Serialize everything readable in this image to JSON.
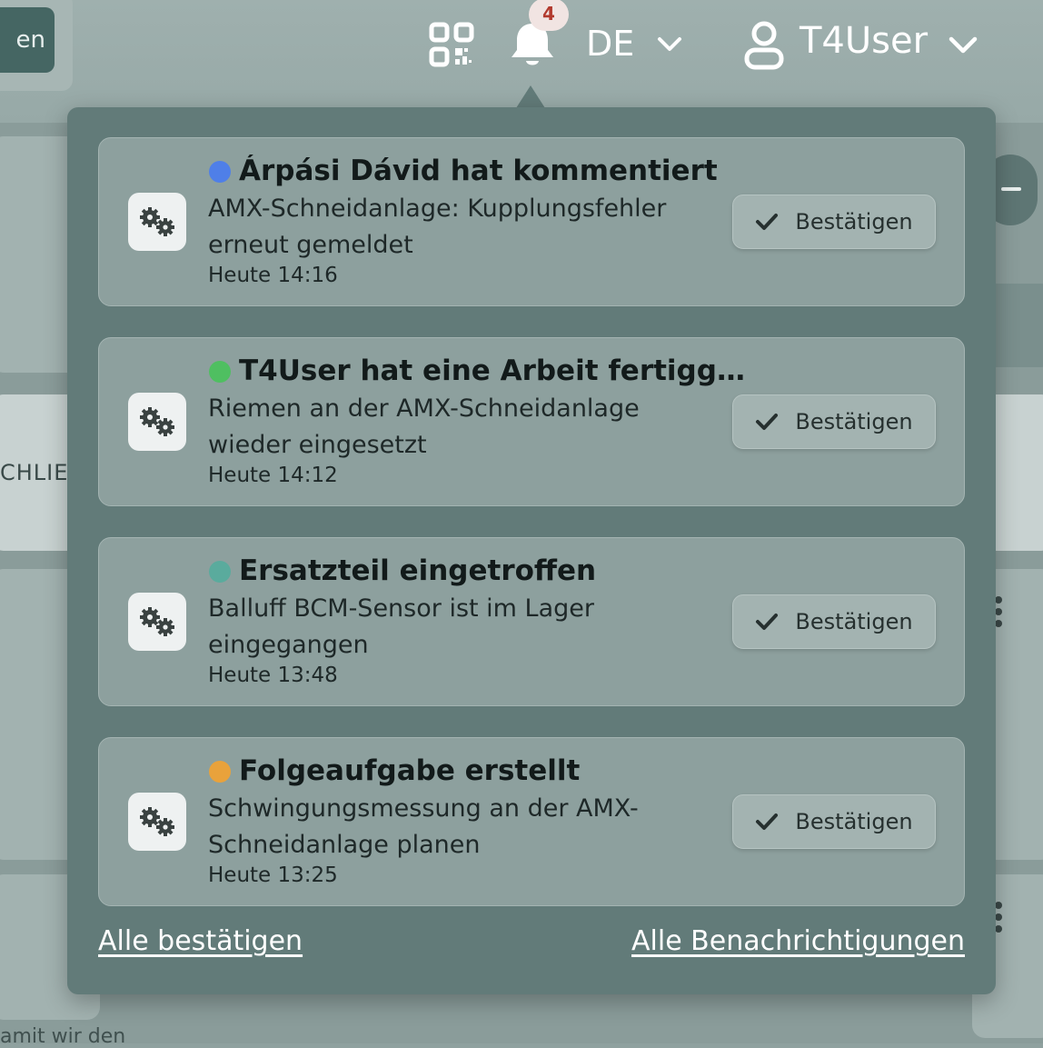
{
  "background": {
    "button_label": "en",
    "side_text": "CHLIE",
    "bottom_text": "amit wir den"
  },
  "nav": {
    "qr_icon": "qr-code-icon",
    "bell_icon": "bell-icon",
    "badge_count": "4",
    "language": "DE",
    "user_icon": "user-icon",
    "user_name": "T4User"
  },
  "notifications": [
    {
      "title": "Árpási Dávid hat kommentiert",
      "body": "AMX-Schneidanlage: Kupplungsfehler erneut gemeldet",
      "time": "Heute 14:16",
      "dot_color": "#4f7fe8",
      "button_label": "Bestätigen"
    },
    {
      "title": "T4User hat eine Arbeit fertigg...",
      "body": "Riemen an der AMX-Schneidanlage wieder eingesetzt",
      "time": "Heute 14:12",
      "dot_color": "#4fbf61",
      "button_label": "Bestätigen"
    },
    {
      "title": "Ersatzteil eingetroffen",
      "body": "Balluff BCM-Sensor ist im Lager eingegangen",
      "time": "Heute 13:48",
      "dot_color": "#5aab9d",
      "button_label": "Bestätigen"
    },
    {
      "title": "Folgeaufgabe erstellt",
      "body": "Schwingungsmessung an der AMX-Schneidanlage planen",
      "time": "Heute 13:25",
      "dot_color": "#e9a23b",
      "button_label": "Bestätigen"
    }
  ],
  "footer": {
    "confirm_all": "Alle bestätigen",
    "all_notifications": "Alle Benachrichtigungen"
  }
}
